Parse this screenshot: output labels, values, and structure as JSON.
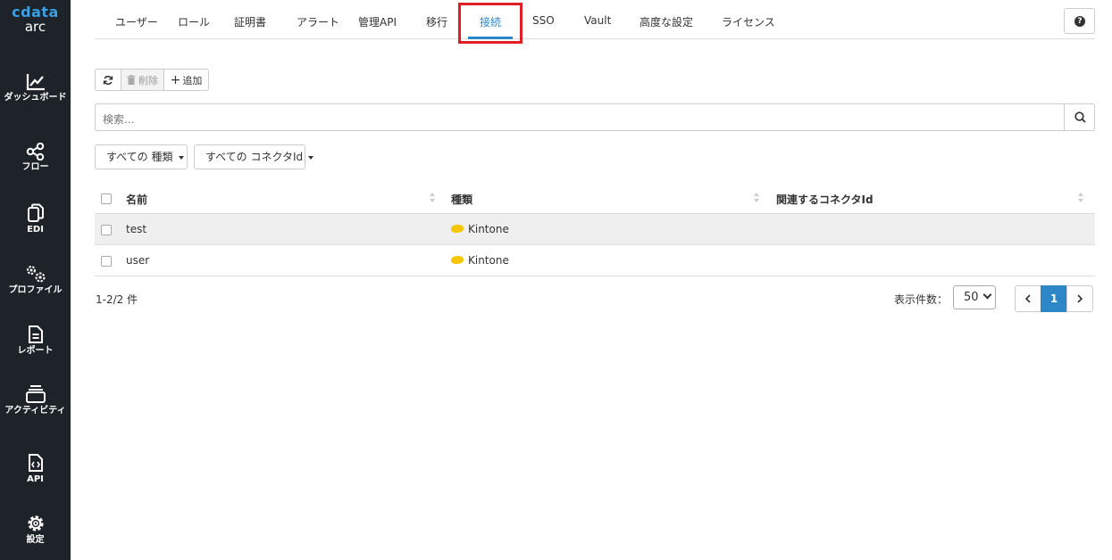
{
  "sidebar": {
    "logo_top": "cdata",
    "logo_bottom": "arc",
    "items": [
      {
        "label": "ダッシュボード",
        "icon": "chart-line-icon"
      },
      {
        "label": "フロー",
        "icon": "share-nodes-icon"
      },
      {
        "label": "EDI",
        "icon": "copy-icon"
      },
      {
        "label": "プロファイル",
        "icon": "gears-icon"
      },
      {
        "label": "レポート",
        "icon": "file-text-icon"
      },
      {
        "label": "アクティビティ",
        "icon": "layers-icon"
      },
      {
        "label": "API",
        "icon": "file-code-icon"
      },
      {
        "label": "設定",
        "icon": "gear-icon"
      }
    ]
  },
  "tabs": [
    {
      "label": "ユーザー",
      "active": false
    },
    {
      "label": "ロール",
      "active": false
    },
    {
      "label": "証明書",
      "active": false
    },
    {
      "label": "アラート",
      "active": false
    },
    {
      "label": "管理API",
      "active": false
    },
    {
      "label": "移行",
      "active": false
    },
    {
      "label": "接続",
      "active": true
    },
    {
      "label": "SSO",
      "active": false
    },
    {
      "label": "Vault",
      "active": false
    },
    {
      "label": "高度な設定",
      "active": false
    },
    {
      "label": "ライセンス",
      "active": false
    }
  ],
  "help_label": "?",
  "toolbar": {
    "delete_label": "削除",
    "add_label": "追加"
  },
  "search": {
    "placeholder": "検索..."
  },
  "filters": {
    "type": "すべての 種類",
    "connector": "すべての コネクタId"
  },
  "table": {
    "headers": {
      "name": "名前",
      "type": "種類",
      "connector": "関連するコネクタId"
    },
    "rows": [
      {
        "name": "test",
        "type": "Kintone",
        "connector": ""
      },
      {
        "name": "user",
        "type": "Kintone",
        "connector": ""
      }
    ]
  },
  "footer": {
    "count": "1-2/2 件",
    "per_page_label": "表示件数：",
    "per_page": "50",
    "current_page": "1"
  },
  "colors": {
    "sidebar_bg": "#1e2329",
    "accent": "#2d87c6",
    "highlight": "#e01e25",
    "kintone": "#f6c700"
  }
}
